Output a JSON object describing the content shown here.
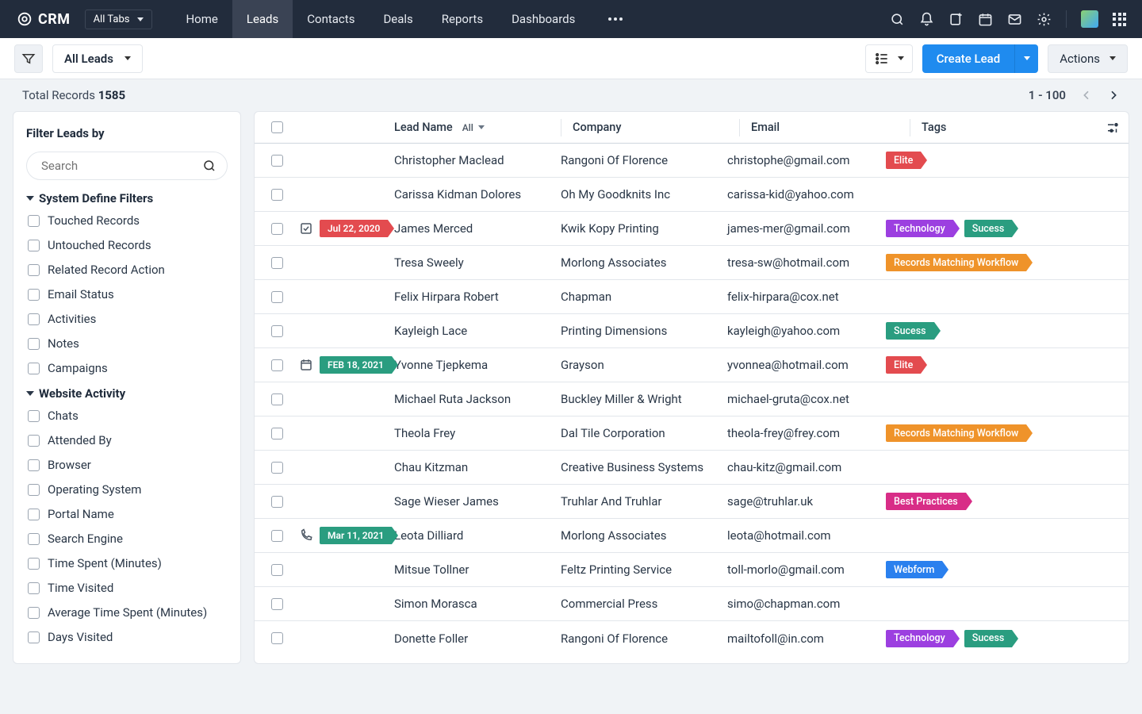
{
  "nav": {
    "brand": "CRM",
    "tabsDropdown": "All Tabs",
    "items": [
      "Home",
      "Leads",
      "Contacts",
      "Deals",
      "Reports",
      "Dashboards"
    ],
    "activeIndex": 1
  },
  "toolbar": {
    "viewName": "All Leads",
    "createLabel": "Create Lead",
    "actionsLabel": "Actions"
  },
  "records": {
    "totalLabel": "Total Records",
    "total": "1585",
    "range": "1 - 100"
  },
  "sidebar": {
    "title": "Filter Leads by",
    "searchPlaceholder": "Search",
    "groups": [
      {
        "title": "System Define Filters",
        "items": [
          "Touched Records",
          "Untouched Records",
          "Related Record Action",
          "Email Status",
          "Activities",
          "Notes",
          "Campaigns"
        ]
      },
      {
        "title": "Website Activity",
        "items": [
          "Chats",
          "Attended By",
          "Browser",
          "Operating System",
          "Portal Name",
          "Search Engine",
          "Time Spent (Minutes)",
          "Time Visited",
          "Average Time Spent (Minutes)",
          "Days Visited"
        ]
      }
    ]
  },
  "table": {
    "headers": {
      "name": "Lead Name",
      "nameSub": "All",
      "company": "Company",
      "email": "Email",
      "tags": "Tags"
    },
    "rows": [
      {
        "name": "Christopher Maclead",
        "company": "Rangoni Of Florence",
        "email": "christophe@gmail.com",
        "tags": [
          {
            "label": "Elite",
            "color": "red"
          }
        ]
      },
      {
        "name": "Carissa Kidman Dolores",
        "company": "Oh My Goodknits Inc",
        "email": "carissa-kid@yahoo.com",
        "tags": []
      },
      {
        "name": "James Merced",
        "company": "Kwik Kopy Printing",
        "email": "james-mer@gmail.com",
        "tags": [
          {
            "label": "Technology",
            "color": "purple"
          },
          {
            "label": "Sucess",
            "color": "green"
          }
        ],
        "date": {
          "label": "Jul 22, 2020",
          "color": "red",
          "icon": "task"
        }
      },
      {
        "name": "Tresa Sweely",
        "company": "Morlong Associates",
        "email": "tresa-sw@hotmail.com",
        "tags": [
          {
            "label": "Records Matching Workflow",
            "color": "orange"
          }
        ]
      },
      {
        "name": "Felix Hirpara Robert",
        "company": "Chapman",
        "email": "felix-hirpara@cox.net",
        "tags": []
      },
      {
        "name": "Kayleigh Lace",
        "company": "Printing Dimensions",
        "email": "kayleigh@yahoo.com",
        "tags": [
          {
            "label": "Sucess",
            "color": "green"
          }
        ]
      },
      {
        "name": "Yvonne Tjepkema",
        "company": "Grayson",
        "email": "yvonnea@hotmail.com",
        "tags": [
          {
            "label": "Elite",
            "color": "red"
          }
        ],
        "date": {
          "label": "FEB 18, 2021",
          "color": "green",
          "icon": "calendar"
        }
      },
      {
        "name": "Michael Ruta Jackson",
        "company": "Buckley Miller & Wright",
        "email": "michael-gruta@cox.net",
        "tags": []
      },
      {
        "name": "Theola Frey",
        "company": "Dal Tile Corporation",
        "email": "theola-frey@frey.com",
        "tags": [
          {
            "label": "Records Matching Workflow",
            "color": "orange"
          }
        ]
      },
      {
        "name": "Chau Kitzman",
        "company": "Creative Business Systems",
        "email": "chau-kitz@gmail.com",
        "tags": []
      },
      {
        "name": "Sage Wieser James",
        "company": "Truhlar And Truhlar",
        "email": "sage@truhlar.uk",
        "tags": [
          {
            "label": "Best Practices",
            "color": "pink"
          }
        ]
      },
      {
        "name": "Leota Dilliard",
        "company": "Morlong Associates",
        "email": "leota@hotmail.com",
        "tags": [],
        "date": {
          "label": "Mar 11, 2021",
          "color": "green",
          "icon": "phone"
        }
      },
      {
        "name": "Mitsue Tollner",
        "company": "Feltz Printing Service",
        "email": "toll-morlo@gmail.com",
        "tags": [
          {
            "label": "Webform",
            "color": "blue"
          }
        ]
      },
      {
        "name": "Simon Morasca",
        "company": "Commercial Press",
        "email": "simo@chapman.com",
        "tags": []
      },
      {
        "name": "Donette Foller",
        "company": "Rangoni Of Florence",
        "email": "mailtofoll@in.com",
        "tags": [
          {
            "label": "Technology",
            "color": "purple"
          },
          {
            "label": "Sucess",
            "color": "green"
          }
        ]
      }
    ]
  }
}
